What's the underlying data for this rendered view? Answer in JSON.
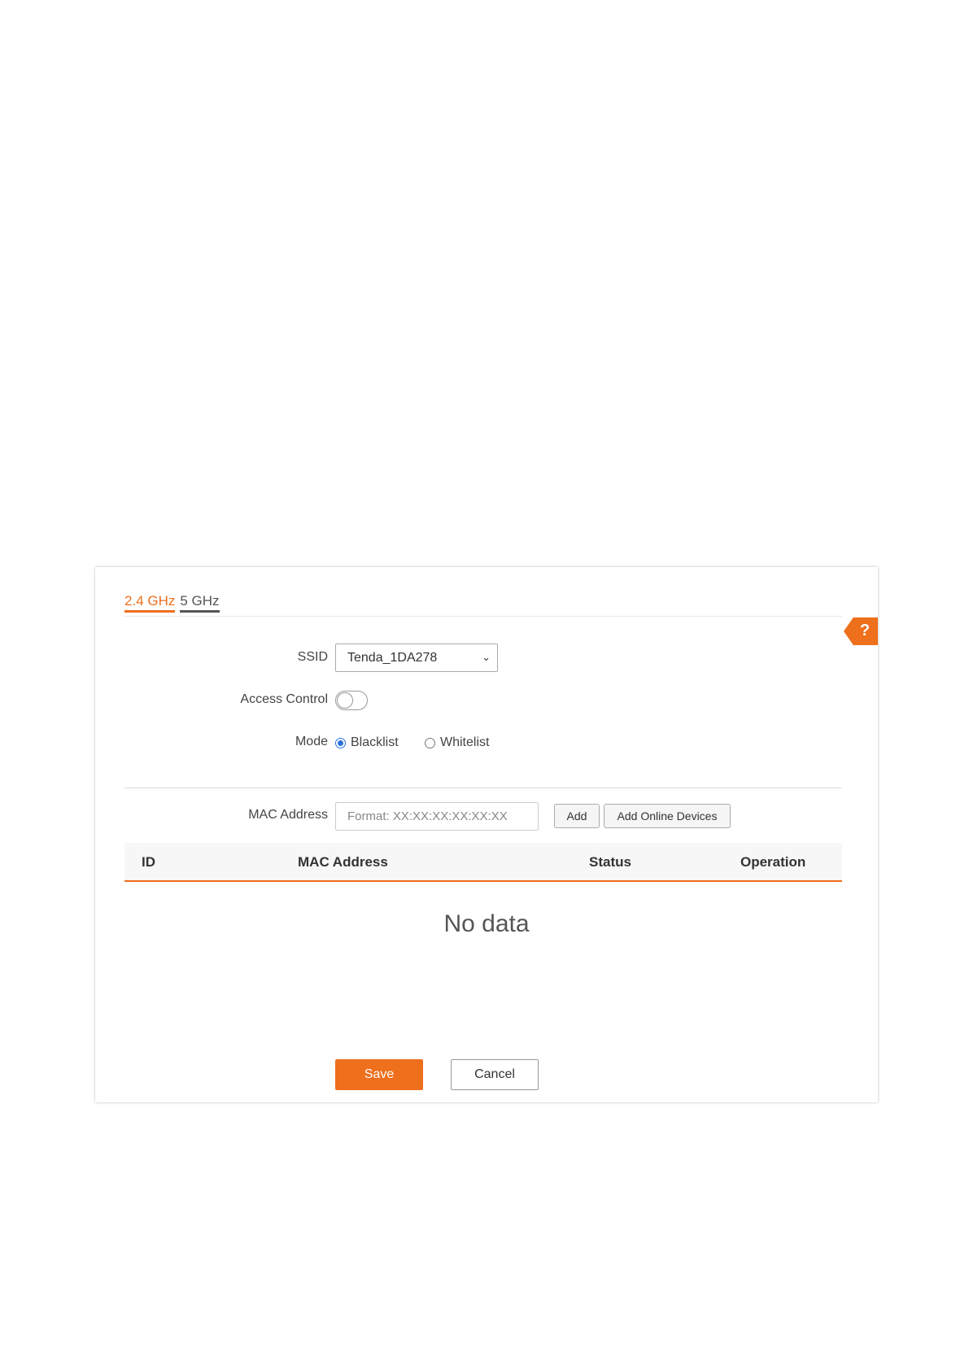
{
  "tabs": {
    "band_24": "2.4 GHz",
    "band_5": "5 GHz"
  },
  "help": {
    "label": "?"
  },
  "form": {
    "ssid_label": "SSID",
    "ssid_value": "Tenda_1DA278",
    "access_control_label": "Access Control",
    "access_control_enabled": false,
    "mode_label": "Mode",
    "mode_blacklist": "Blacklist",
    "mode_whitelist": "Whitelist",
    "mode_selected": "Blacklist",
    "mac_label": "MAC Address",
    "mac_placeholder": "Format: XX:XX:XX:XX:XX:XX",
    "add_button": "Add",
    "add_online_button": "Add Online Devices"
  },
  "table": {
    "columns": [
      "ID",
      "MAC Address",
      "Status",
      "Operation"
    ],
    "rows": [],
    "empty_text": "No data"
  },
  "actions": {
    "save": "Save",
    "cancel": "Cancel"
  },
  "colors": {
    "accent": "#ee6f1c",
    "radio": "#2a72e0"
  }
}
